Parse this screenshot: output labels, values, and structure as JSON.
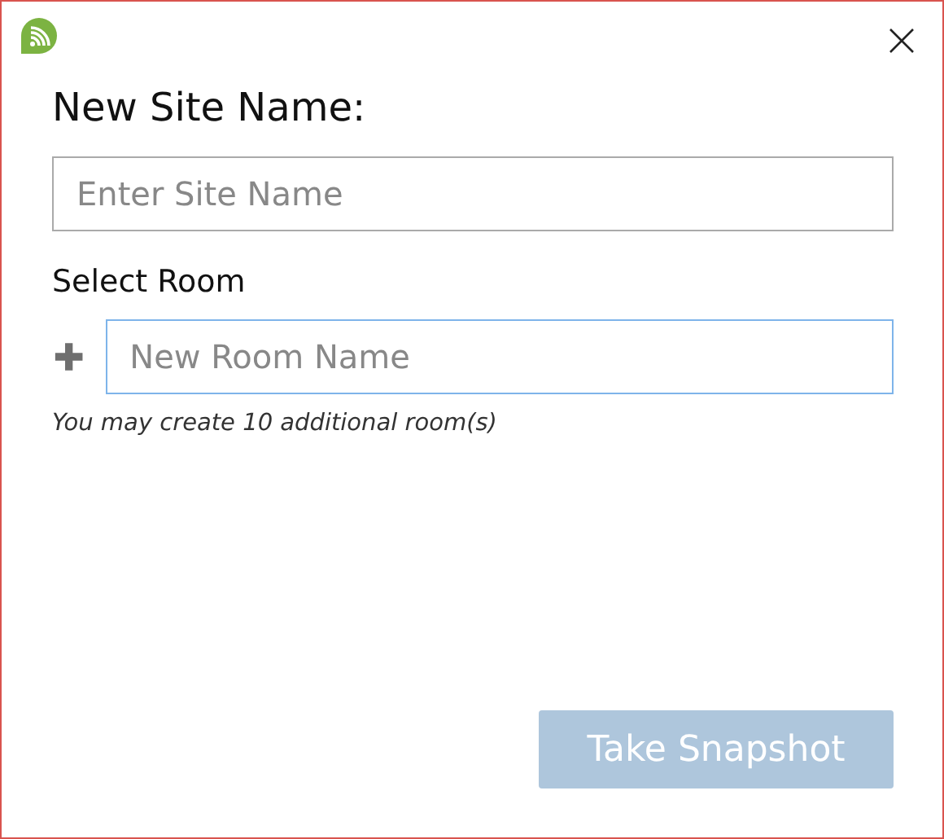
{
  "heading": "New Site Name:",
  "site_field": {
    "placeholder": "Enter Site Name"
  },
  "room_label": "Select Room",
  "room_field": {
    "placeholder": "New Room Name",
    "focused": true
  },
  "note": "You may create 10 additional room(s)",
  "snapshot_button": {
    "label": "Take Snapshot",
    "disabled": true
  }
}
